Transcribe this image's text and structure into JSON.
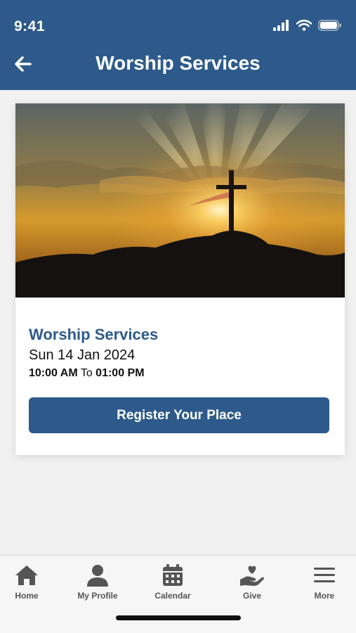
{
  "status_bar": {
    "time": "9:41"
  },
  "header": {
    "title": "Worship Services"
  },
  "event": {
    "title": "Worship Services",
    "date": "Sun 14 Jan 2024",
    "start_time": "10:00 AM",
    "to_label": "To",
    "end_time": "01:00 PM",
    "register_label": "Register Your Place"
  },
  "tabs": [
    {
      "label": "Home",
      "icon": "home-icon"
    },
    {
      "label": "My Profile",
      "icon": "profile-icon"
    },
    {
      "label": "Calendar",
      "icon": "calendar-icon"
    },
    {
      "label": "Give",
      "icon": "give-icon"
    },
    {
      "label": "More",
      "icon": "menu-icon"
    }
  ],
  "colors": {
    "primary": "#2d5a8a",
    "background": "#f1f1f2",
    "tab_icon": "#555555"
  }
}
